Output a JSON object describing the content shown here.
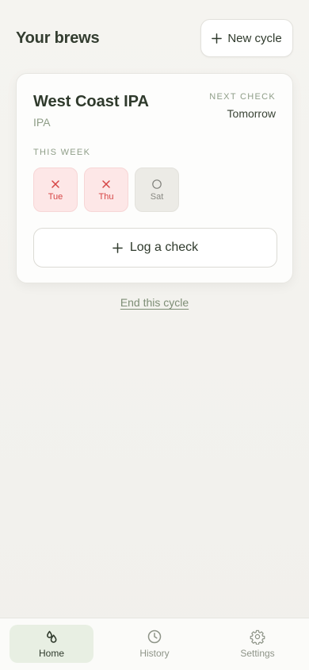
{
  "header": {
    "title": "Your brews",
    "new_cycle_label": "New cycle",
    "new_cycle_icon": "plus-icon"
  },
  "brew": {
    "name": "West Coast IPA",
    "style": "IPA",
    "next_check_label": "NEXT CHECK",
    "next_check_value": "Tomorrow",
    "week_label": "THIS WEEK",
    "days": [
      {
        "label": "Tue",
        "status": "missed",
        "icon": "x-icon"
      },
      {
        "label": "Thu",
        "status": "missed",
        "icon": "x-icon"
      },
      {
        "label": "Sat",
        "status": "pending",
        "icon": "circle-icon"
      }
    ],
    "log_label": "Log a check",
    "log_icon": "plus-icon"
  },
  "end_cycle_label": "End this cycle",
  "tabs": [
    {
      "label": "Home",
      "icon": "drops-icon",
      "active": true
    },
    {
      "label": "History",
      "icon": "clock-icon",
      "active": false
    },
    {
      "label": "Settings",
      "icon": "gear-icon",
      "active": false
    }
  ],
  "colors": {
    "accent": "#2f3a2c",
    "muted": "#8f9e88",
    "missed": "#d64545",
    "missed_bg": "#fde7e7",
    "active_tab_bg": "#e8efe3"
  }
}
